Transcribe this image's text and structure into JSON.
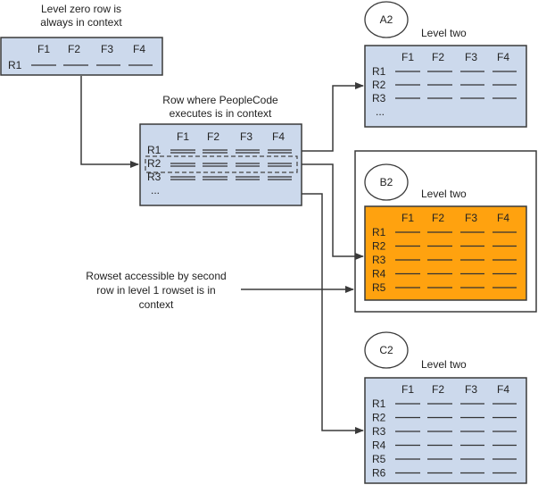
{
  "colors": {
    "rowset_fill": "#ccd9ec",
    "highlight_fill": "#ffa20f",
    "stroke": "#3a3a3a"
  },
  "annotations": {
    "level0_caption": [
      "Level zero row is",
      "always in context"
    ],
    "level1_caption": [
      "Row where PeopleCode",
      "executes is in context"
    ],
    "rowset_caption": [
      "Rowset accessible by second",
      "row in level 1 rowset is in",
      "context"
    ]
  },
  "rowsets": {
    "level0": {
      "fields": [
        "F1",
        "F2",
        "F3",
        "F4"
      ],
      "rows": [
        "R1"
      ],
      "ellipsis": ""
    },
    "level1": {
      "fields": [
        "F1",
        "F2",
        "F3",
        "F4"
      ],
      "rows": [
        "R1",
        "R2",
        "R3"
      ],
      "ellipsis": "...",
      "current_row": "R2"
    },
    "a2": {
      "badge": "A2",
      "caption": "Level two",
      "fields": [
        "F1",
        "F2",
        "F3",
        "F4"
      ],
      "rows": [
        "R1",
        "R2",
        "R3"
      ],
      "ellipsis": "..."
    },
    "b2": {
      "badge": "B2",
      "caption": "Level two",
      "fields": [
        "F1",
        "F2",
        "F3",
        "F4"
      ],
      "rows": [
        "R1",
        "R2",
        "R3",
        "R4",
        "R5"
      ],
      "ellipsis": "",
      "in_context": true
    },
    "c2": {
      "badge": "C2",
      "caption": "Level two",
      "fields": [
        "F1",
        "F2",
        "F3",
        "F4"
      ],
      "rows": [
        "R1",
        "R2",
        "R3",
        "R4",
        "R5",
        "R6"
      ],
      "ellipsis": ""
    }
  }
}
